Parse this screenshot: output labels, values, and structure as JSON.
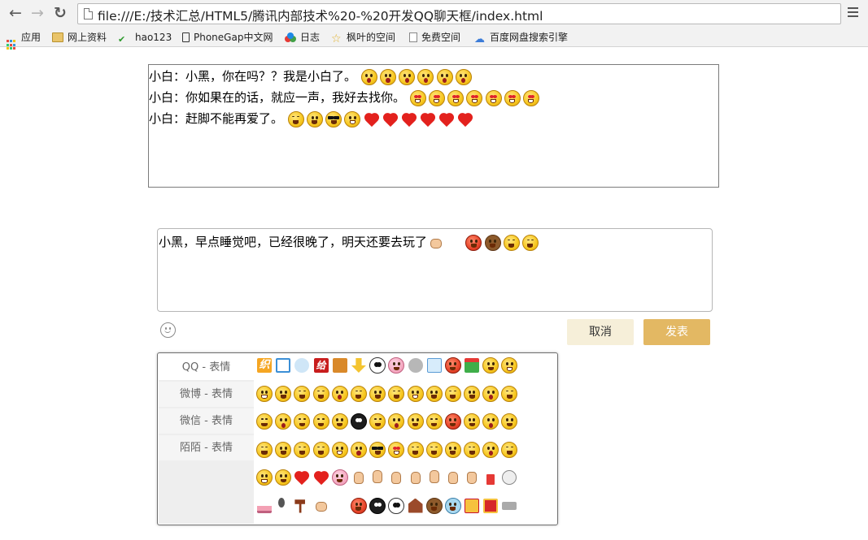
{
  "browser": {
    "url": "file:///E:/技术汇总/HTML5/腾讯内部技术%20-%20开发QQ聊天框/index.html",
    "nav": {
      "back": "←",
      "forward": "→",
      "reload": "↻"
    },
    "bookmarks": [
      {
        "label": "应用",
        "icon": "apps-icon"
      },
      {
        "label": "网上资料",
        "icon": "folder-icon"
      },
      {
        "label": "hao123",
        "icon": "hao123-icon"
      },
      {
        "label": "PhoneGap中文网",
        "icon": "phonegap-icon"
      },
      {
        "label": "日志",
        "icon": "rgb-circles-icon"
      },
      {
        "label": "枫叶的空间",
        "icon": "star-icon"
      },
      {
        "label": "免费空间",
        "icon": "document-icon"
      },
      {
        "label": "百度网盘搜索引擎",
        "icon": "baidu-cloud-icon"
      }
    ]
  },
  "chat": {
    "messages": [
      {
        "text": "小白：小黑，你在吗？？我是小白了。"
      },
      {
        "text": "小白：你如果在的话，就应一声，我好去找你。"
      },
      {
        "text": "小白：赶脚不能再爱了。"
      }
    ]
  },
  "compose": {
    "text": "小黑，早点睡觉吧，已经很晚了，明天还要去玩了"
  },
  "actions": {
    "cancel": "取消",
    "send": "发表"
  },
  "emoji_panel": {
    "tabs": [
      {
        "label": "QQ - 表情"
      },
      {
        "label": "微博 - 表情"
      },
      {
        "label": "微信 - 表情"
      },
      {
        "label": "陌陌 - 表情"
      }
    ],
    "glyph_tile": "织",
    "glyph_tile_2": "给"
  },
  "colors": {
    "send_button": "#e3b863",
    "cancel_button": "#f6efd9",
    "chrome_bg": "#f2f2f2"
  }
}
